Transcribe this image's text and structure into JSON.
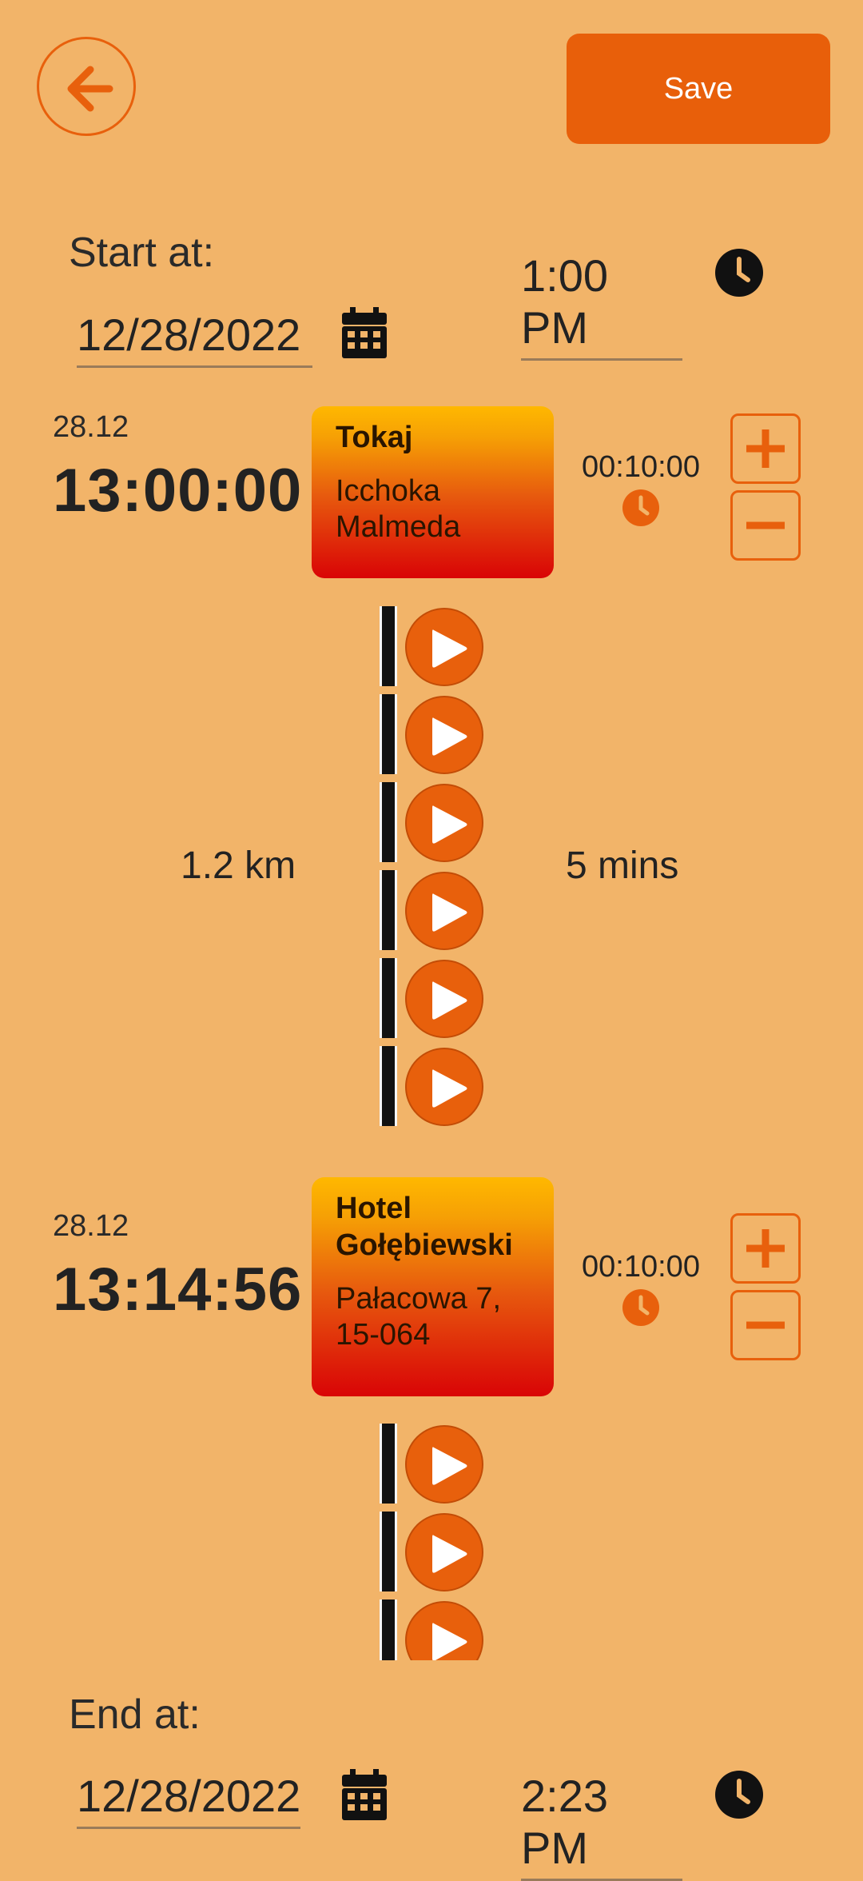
{
  "header": {
    "save_label": "Save"
  },
  "start": {
    "label": "Start at:",
    "date": "12/28/2022",
    "time": "1:00 PM"
  },
  "stops": [
    {
      "date": "28.12",
      "time": "13:00:00",
      "name": "Tokaj",
      "address": "Icchoka Malmeda",
      "duration": "00:10:00"
    },
    {
      "date": "28.12",
      "time": "13:14:56",
      "name": "Hotel Gołębiewski",
      "address": "Pałacowa 7, 15-064",
      "duration": "00:10:00"
    }
  ],
  "segment": {
    "distance": "1.2 km",
    "travel_time": "5 mins"
  },
  "end": {
    "label": "End at:",
    "date": "12/28/2022",
    "time": "2:23 PM"
  },
  "colors": {
    "background": "#F2B469",
    "accent": "#E85F0A"
  }
}
